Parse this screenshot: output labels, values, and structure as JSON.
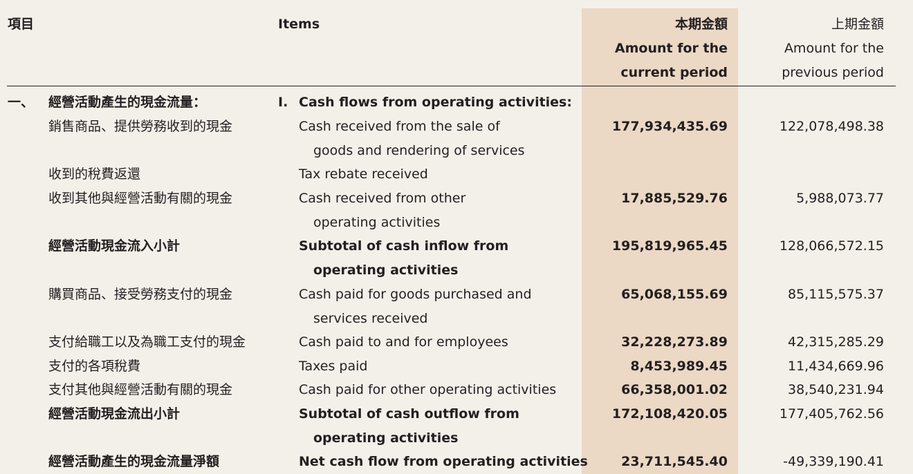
{
  "header": {
    "col_zh_label": "項目",
    "col_en_label": "Items",
    "current_zh": "本期金額",
    "current_en_line1": "Amount for the",
    "current_en_line2": "current period",
    "previous_zh": "上期金額",
    "previous_en_line1": "Amount for the",
    "previous_en_line2": "previous period"
  },
  "section": {
    "zh_number": "一、",
    "zh_title": "經營活動產生的現金流量：",
    "en_number": "I.",
    "en_title": "Cash flows from operating activities:"
  },
  "rows": [
    {
      "zh": "銷售商品、提供勞務收到的現金",
      "en1": "Cash received from the sale of",
      "en2": "goods and rendering of services",
      "current": "177,934,435.69",
      "previous": "122,078,498.38"
    },
    {
      "zh": "收到的稅費返還",
      "en1": "Tax rebate received",
      "current": "",
      "previous": ""
    },
    {
      "zh": "收到其他與經營活動有關的現金",
      "en1": "Cash received from other",
      "en2": "operating activities",
      "current": "17,885,529.76",
      "previous": "5,988,073.77"
    },
    {
      "zh": "經營活動現金流入小計",
      "en1": "Subtotal of cash inflow from",
      "en2": "operating activities",
      "current": "195,819,965.45",
      "previous": "128,066,572.15"
    },
    {
      "zh": "購買商品、接受勞務支付的現金",
      "en1": "Cash paid for goods purchased and",
      "en2": "services received",
      "current": "65,068,155.69",
      "previous": "85,115,575.37"
    },
    {
      "zh": "支付給職工以及為職工支付的現金",
      "en1": "Cash paid to and for employees",
      "current": "32,228,273.89",
      "previous": "42,315,285.29"
    },
    {
      "zh": "支付的各項稅費",
      "en1": "Taxes paid",
      "current": "8,453,989.45",
      "previous": "11,434,669.96"
    },
    {
      "zh": "支付其他與經營活動有關的現金",
      "en1": "Cash paid for other operating activities",
      "current": "66,358,001.02",
      "previous": "38,540,231.94"
    },
    {
      "zh": "經營活動現金流出小計",
      "en1": "Subtotal of cash outflow from",
      "en2": "operating activities",
      "current": "172,108,420.05",
      "previous": "177,405,762.56"
    },
    {
      "zh": "經營活動產生的現金流量淨額",
      "en1": "Net cash flow from operating activities",
      "current": "23,711,545.40",
      "previous": "-49,339,190.41"
    }
  ],
  "colors": {
    "background": "#f3f0ea",
    "current_period_band": "#ebd8c5",
    "text": "#231f20"
  }
}
